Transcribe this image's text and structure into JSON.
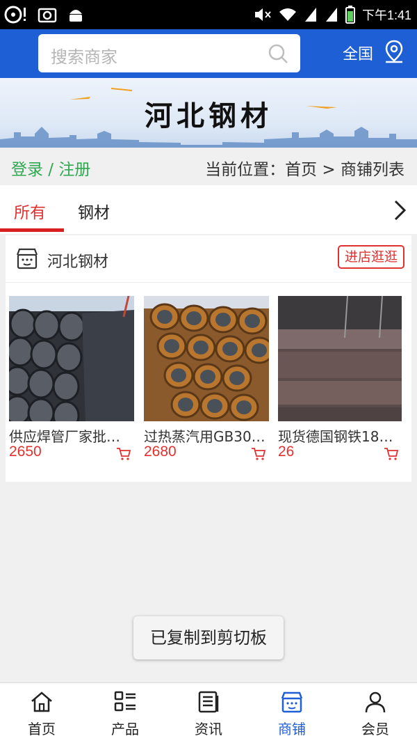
{
  "status_bar": {
    "time": "下午1:41"
  },
  "header": {
    "search_placeholder": "搜索商家",
    "region": "全国"
  },
  "banner": {
    "title": "河北钢材"
  },
  "crumbs": {
    "login": "登录 / 注册",
    "location": "当前位置：首页 > 商铺列表"
  },
  "tabs": [
    {
      "label": "所有",
      "active": true
    },
    {
      "label": "钢材",
      "active": false
    }
  ],
  "shop": {
    "name": "河北钢材",
    "visit_label": "进店逛逛",
    "products": [
      {
        "name": "供应焊管厂家批…",
        "price": "2650"
      },
      {
        "name": "过热蒸汽用GB30…",
        "price": "2680"
      },
      {
        "name": "现货德国钢铁18…",
        "price": "26"
      }
    ]
  },
  "toast": "已复制到剪切板",
  "bottom_nav": [
    {
      "label": "首页",
      "icon": "home-icon"
    },
    {
      "label": "产品",
      "icon": "product-list-icon"
    },
    {
      "label": "资讯",
      "icon": "news-icon"
    },
    {
      "label": "商铺",
      "icon": "store-icon",
      "active": true
    },
    {
      "label": "会员",
      "icon": "user-icon"
    }
  ],
  "colors": {
    "primary": "#1f5fd6",
    "accent_red": "#e03131",
    "login_green": "#2fa84f"
  }
}
